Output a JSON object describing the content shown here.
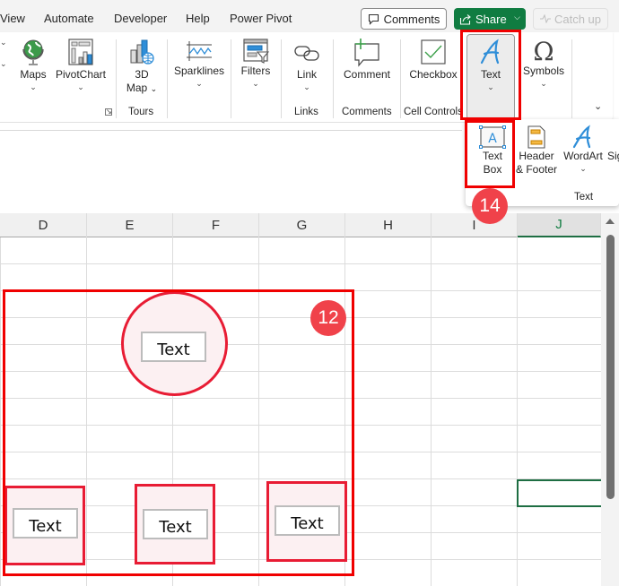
{
  "menu": {
    "tabs": [
      "View",
      "Automate",
      "Developer",
      "Help",
      "Power Pivot"
    ],
    "comments_label": "Comments",
    "share_label": "Share",
    "catchup_label": "Catch up"
  },
  "ribbon": {
    "buttons": {
      "maps": "Maps",
      "pivotchart": "PivotChart",
      "map3d_line1": "3D",
      "map3d_line2": "Map",
      "sparklines": "Sparklines",
      "filters": "Filters",
      "link": "Link",
      "comment": "Comment",
      "checkbox": "Checkbox",
      "text": "Text",
      "symbols": "Symbols"
    },
    "groups": {
      "tours": "Tours",
      "links": "Links",
      "comments": "Comments",
      "cell_controls": "Cell Controls"
    }
  },
  "popup": {
    "textbox_line1": "Text",
    "textbox_line2": "Box",
    "header_line1": "Header",
    "header_line2": "& Footer",
    "wordart": "WordArt",
    "signature_partial": "Sig",
    "group_label": "Text"
  },
  "sheet": {
    "columns": [
      "D",
      "E",
      "F",
      "G",
      "H",
      "I",
      "J"
    ],
    "selected_column": "J",
    "shapes": [
      {
        "type": "circle",
        "text": "Text"
      },
      {
        "type": "rectangle",
        "text": "Text"
      },
      {
        "type": "rectangle",
        "text": "Text"
      },
      {
        "type": "rectangle",
        "text": "Text"
      }
    ]
  },
  "annotations": {
    "badge_12": "12",
    "badge_14": "14",
    "highlight_color": "#f00000",
    "badge_color": "#f0424a"
  },
  "colors": {
    "share_green": "#107c41",
    "selection_green": "#1e6e43",
    "shape_border": "#e81c34",
    "shape_fill": "#fcf0f2"
  }
}
